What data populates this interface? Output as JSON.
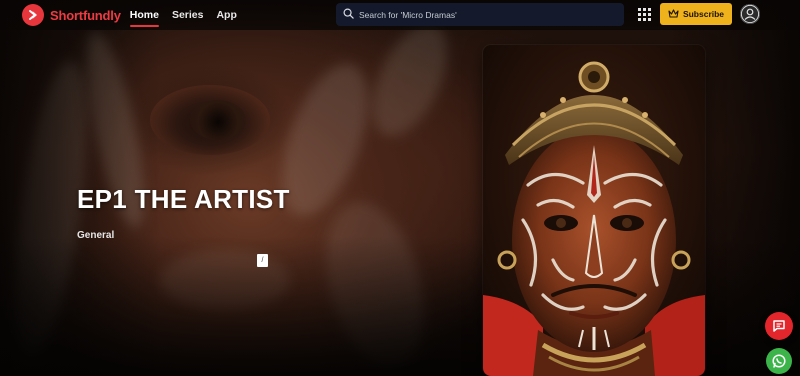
{
  "brand": {
    "name": "Shortfundly",
    "accent": "#e8363d"
  },
  "nav": {
    "items": [
      {
        "label": "Home",
        "active": true
      },
      {
        "label": "Series",
        "active": false
      },
      {
        "label": "App",
        "active": false
      }
    ]
  },
  "search": {
    "placeholder": "Search for 'Micro Dramas'",
    "icon": "search-icon"
  },
  "header": {
    "apps_icon": "grid-icon",
    "subscribe_label": "Subscribe",
    "subscribe_icon": "crown-icon",
    "subscribe_color": "#f0b21c",
    "avatar_icon": "user-icon"
  },
  "hero": {
    "title": "EP1 THE ARTIST",
    "genre": "General",
    "mini_button_label": "/"
  },
  "fabs": {
    "chat_icon": "chat-icon",
    "chat_color": "#e3262c",
    "whatsapp_icon": "whatsapp-icon",
    "whatsapp_color": "#3cb44a"
  }
}
